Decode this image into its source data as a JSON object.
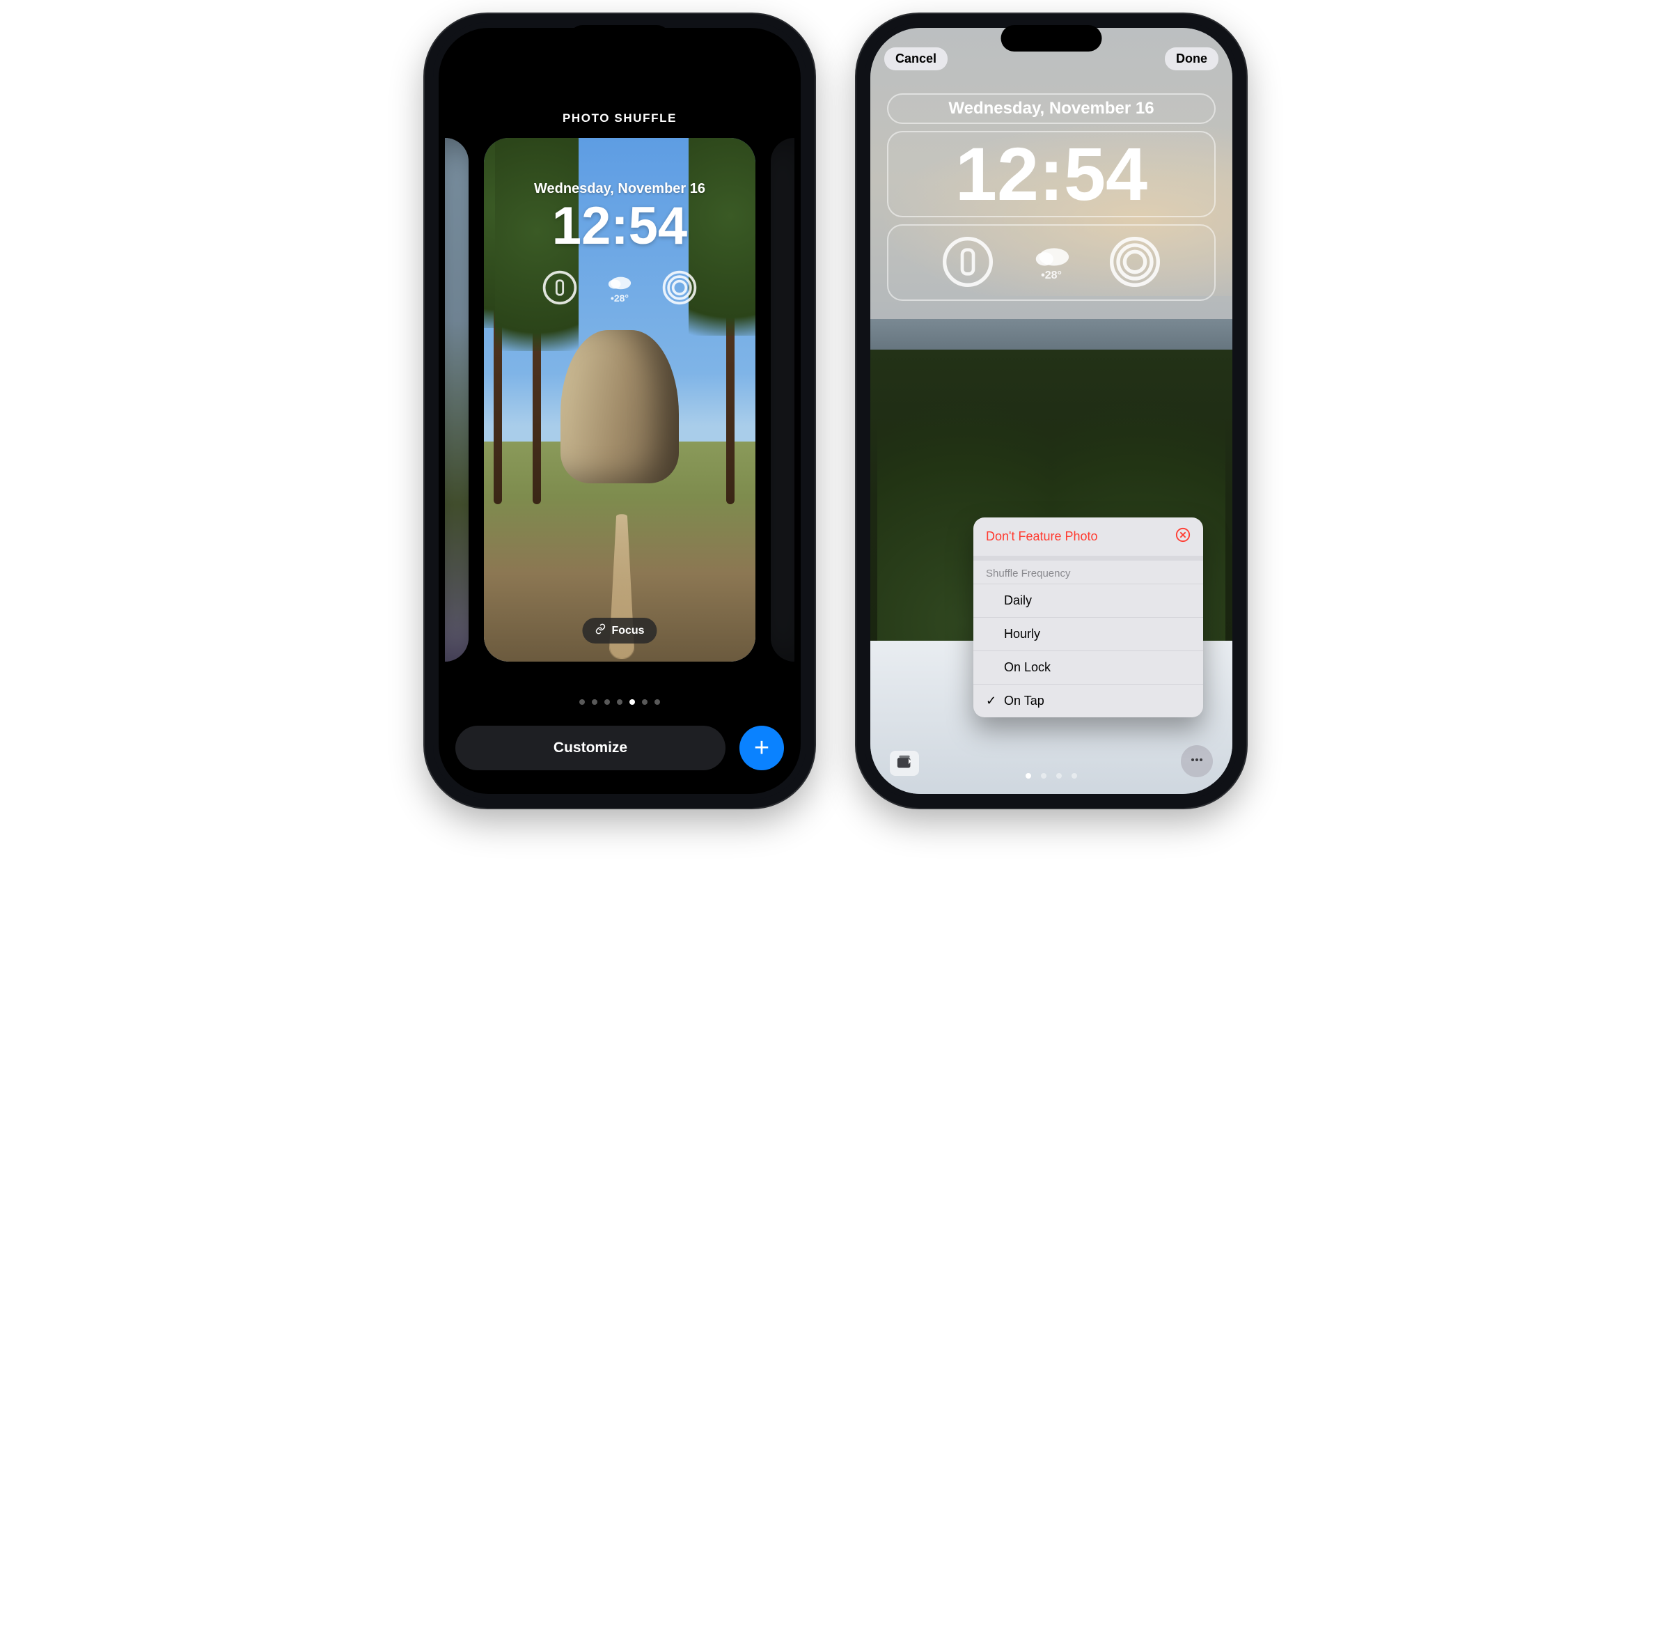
{
  "left": {
    "title": "PHOTO SHUFFLE",
    "date": "Wednesday, November 16",
    "time": "12:54",
    "weatherTemp": "•28°",
    "focus": "Focus",
    "customize": "Customize",
    "pages": {
      "count": 7,
      "active": 4
    }
  },
  "right": {
    "cancel": "Cancel",
    "done": "Done",
    "date": "Wednesday, November 16",
    "time": "12:54",
    "weatherTemp": "•28°",
    "menu": {
      "dontFeature": "Don't Feature Photo",
      "sectionHeader": "Shuffle Frequency",
      "options": [
        {
          "label": "Daily",
          "selected": false
        },
        {
          "label": "Hourly",
          "selected": false
        },
        {
          "label": "On Lock",
          "selected": false
        },
        {
          "label": "On Tap",
          "selected": true
        }
      ]
    },
    "styleDots": {
      "count": 4,
      "active": 0
    }
  }
}
